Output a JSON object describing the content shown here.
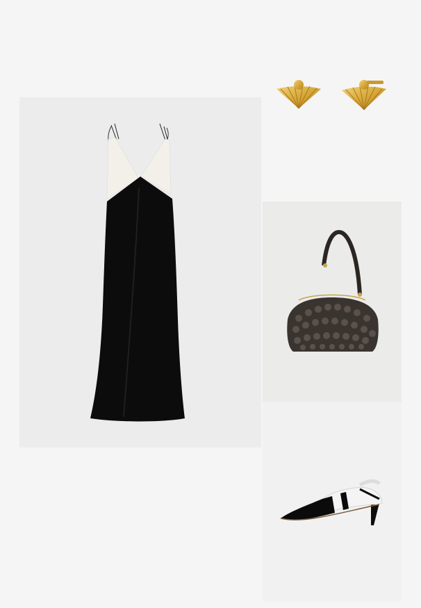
{
  "page": {
    "title": "",
    "background": "#f5f5f5"
  },
  "items": [
    {
      "name": "dress",
      "icon": "black-white-satin-maxi-dress"
    },
    {
      "name": "earrings",
      "icon": "gold-fan-stud-earrings"
    },
    {
      "name": "bag",
      "icon": "woven-leather-shoulder-bag"
    },
    {
      "name": "shoe",
      "icon": "black-white-slingback-kitten-heel"
    }
  ]
}
